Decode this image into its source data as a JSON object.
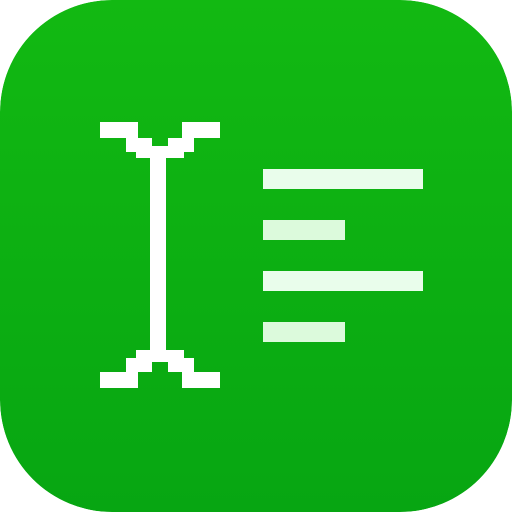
{
  "icon": {
    "name": "text-cursor-lines-app-icon",
    "gradient_top": "#12B912",
    "gradient_bottom": "#07A612",
    "cursor_color": "#FFFFFF",
    "line_color_primary": "#E9FDEB",
    "line_color_secondary": "#DCFADC"
  }
}
